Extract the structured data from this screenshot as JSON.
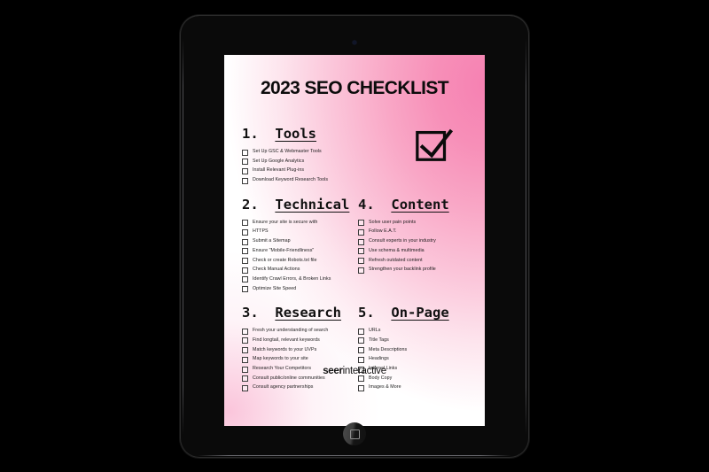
{
  "device": {
    "type": "tablet",
    "camera_label": "front-camera",
    "home_button_label": "home-button"
  },
  "poster": {
    "title": "2023 SEO CHECKLIST",
    "logo_bold": "seer",
    "logo_regular": "interactive",
    "check_icon_name": "checkbox-check-icon",
    "colors": {
      "accent_pink": "#f78fb8",
      "deep_pink": "#f681b2",
      "ink": "#0c0c0c",
      "paper": "#ffffff",
      "device_black": "#0a0a0a",
      "background": "#000000"
    },
    "sections": [
      {
        "number": "1.",
        "title": "Tools",
        "items": [
          "Set Up GSC & Webmaster Tools",
          "Set Up Google Analytics",
          "Install Relevant Plug-ins",
          "Download Keyword Research Tools"
        ]
      },
      {
        "number": "2.",
        "title": "Technical",
        "items": [
          "Ensure your site is secure with",
          "HTTPS",
          "Submit a Sitemap",
          "Ensure \"Mobile-Friendliness\"",
          "Check or create Robots.txt file",
          "Check Manual Actions",
          "Identify Crawl Errors, & Broken Links",
          "Optimize Site Speed"
        ]
      },
      {
        "number": "3.",
        "title": "Research",
        "items": [
          "Fresh your understanding of search",
          "Find longtail, relevant keywords",
          "Match keywords to your UVPs",
          "Map keywords to your site",
          "Research Your Competitors",
          "Consult public/online communities",
          "Consult agency partnerships"
        ]
      },
      {
        "number": "4.",
        "title": "Content",
        "items": [
          "Solve user pain points",
          "Follow E.A.T.",
          "Consult experts in your industry",
          "Use schema & multimedia",
          "Refresh outdated content",
          "Strengthen your backlink profile"
        ]
      },
      {
        "number": "5.",
        "title": "On-Page",
        "items": [
          "URLs",
          "Title Tags",
          "Meta Descriptions",
          "Headings",
          "Internal Links",
          "Body Copy",
          "Images & More"
        ]
      }
    ]
  }
}
